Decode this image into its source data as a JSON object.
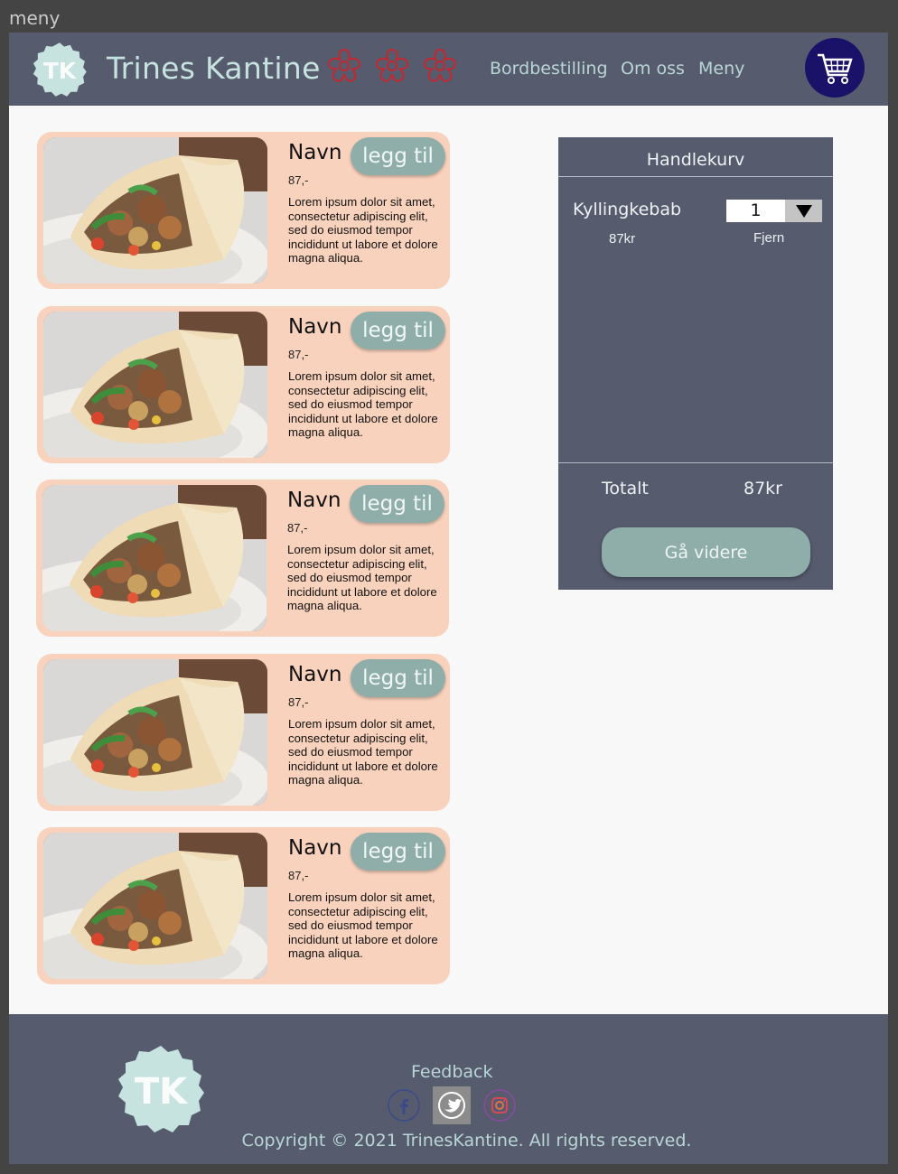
{
  "frame_label": "meny",
  "header": {
    "logo_text": "TK",
    "brand": "Trines Kantine",
    "nav": [
      {
        "label": "Bordbestilling"
      },
      {
        "label": "Om oss"
      },
      {
        "label": "Meny"
      }
    ],
    "cart_icon": "shopping-cart-icon",
    "rating_icon": "flower-outline-icon",
    "rating_count": 3
  },
  "menu_items": [
    {
      "name": "Navn",
      "add_label": "legg til",
      "price": "87,-",
      "description": "Lorem ipsum dolor sit amet, consectetur adipiscing elit, sed do eiusmod tempor incididunt ut labore et dolore magna aliqua."
    },
    {
      "name": "Navn",
      "add_label": "legg til",
      "price": "87,-",
      "description": "Lorem ipsum dolor sit amet, consectetur adipiscing elit, sed do eiusmod tempor incididunt ut labore et dolore magna aliqua."
    },
    {
      "name": "Navn",
      "add_label": "legg til",
      "price": "87,-",
      "description": "Lorem ipsum dolor sit amet, consectetur adipiscing elit, sed do eiusmod tempor incididunt ut labore et dolore magna aliqua."
    },
    {
      "name": "Navn",
      "add_label": "legg til",
      "price": "87,-",
      "description": "Lorem ipsum dolor sit amet, consectetur adipiscing elit, sed do eiusmod tempor incididunt ut labore et dolore magna aliqua."
    },
    {
      "name": "Navn",
      "add_label": "legg til",
      "price": "87,-",
      "description": "Lorem ipsum dolor sit amet, consectetur adipiscing elit, sed do eiusmod tempor incididunt ut labore et dolore magna aliqua."
    }
  ],
  "cart": {
    "title": "Handlekurv",
    "items": [
      {
        "name": "Kyllingkebab",
        "quantity": "1",
        "price": "87kr",
        "remove_label": "Fjern"
      }
    ],
    "total_label": "Totalt",
    "total_value": "87kr",
    "proceed_label": "Gå videre"
  },
  "footer": {
    "logo_text": "TK",
    "feedback": "Feedback",
    "social": [
      "facebook-icon",
      "twitter-icon",
      "instagram-icon"
    ],
    "copyright": "Copyright © 2021 TrinesKantine. All rights reserved."
  },
  "colors": {
    "header_bg": "#565b6d",
    "card_bg": "#f9d2bd",
    "button": "#8faeaa",
    "cart_button": "#1a1168",
    "logo": "#c6e3df"
  }
}
